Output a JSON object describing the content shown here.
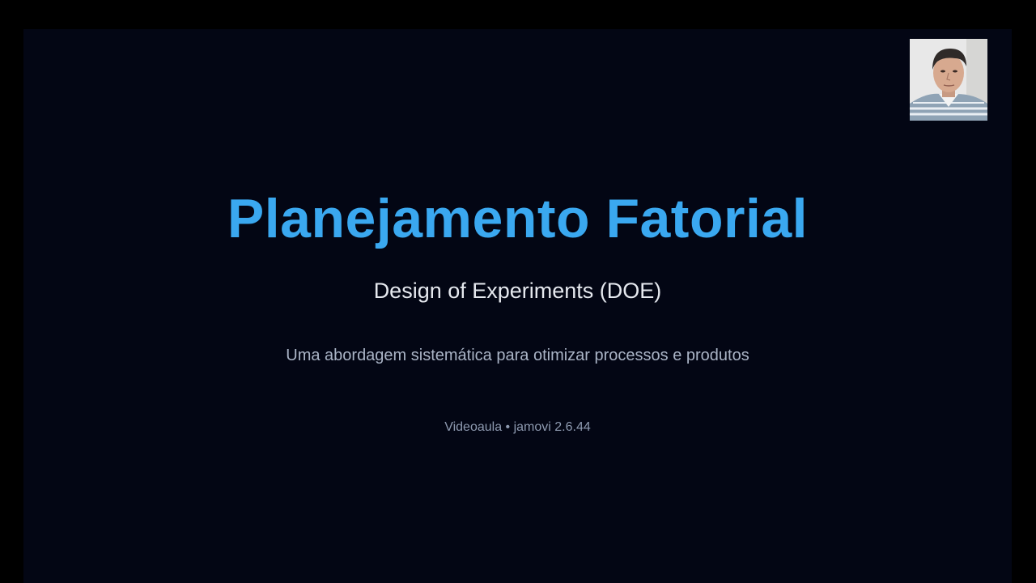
{
  "slide": {
    "title": "Planejamento Fatorial",
    "subtitle": "Design of Experiments (DOE)",
    "tagline": "Uma abordagem sistemática para otimizar processos e produtos",
    "footer": "Videoaula • jamovi 2.6.44"
  },
  "webcam": {
    "content": "presenter-video"
  },
  "colors": {
    "background": "#030614",
    "title": "#3aa8f0",
    "subtitle": "#e6e9ef",
    "tagline": "#aab4c6",
    "footer": "#8e9ab0"
  }
}
